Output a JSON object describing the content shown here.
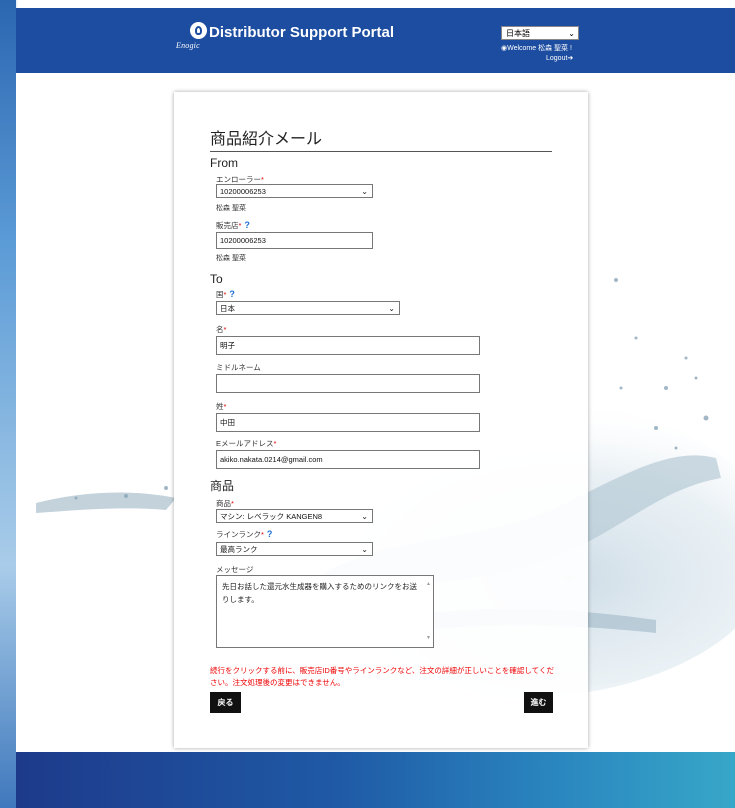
{
  "header": {
    "logo_text": "Enogic",
    "portal_title": "Distributor Support Portal",
    "language": "日本語",
    "welcome": "Welcome 松森 聖菜 !",
    "logout": "Logout"
  },
  "form": {
    "title": "商品紹介メール",
    "from": {
      "section": "From",
      "enroller_label": "エンローラー",
      "enroller_value": "10200006253",
      "enroller_name": "松森 聖菜",
      "seller_label": "販売店",
      "seller_value": "10200006253",
      "seller_name": "松森 聖菜"
    },
    "to": {
      "section": "To",
      "country_label": "国",
      "country_value": "日本",
      "first_name_label": "名",
      "first_name_value": "明子",
      "middle_name_label": "ミドルネーム",
      "middle_name_value": "",
      "last_name_label": "姓",
      "last_name_value": "中田",
      "email_label": "Eメールアドレス",
      "email_value": "akiko.nakata.0214@gmail.com"
    },
    "product": {
      "section": "商品",
      "product_label": "商品",
      "product_value": "マシン: レベラック KANGEN8",
      "rank_label": "ラインランク",
      "rank_value": "最高ランク",
      "message_label": "メッセージ",
      "message_value": "先日お話した還元水生成器を購入するためのリンクをお送りします。"
    },
    "warning": "続行をクリックする前に、販売店ID番号やラインランクなど、注文の詳細が正しいことを確認してください。注文処理後の変更はできません。",
    "back_label": "戻る",
    "next_label": "進む"
  },
  "colors": {
    "header_bg": "#1c4da0",
    "required": "#dd0000",
    "help": "#1a6fd4",
    "warning": "#ee0000",
    "button_bg": "#111111"
  }
}
